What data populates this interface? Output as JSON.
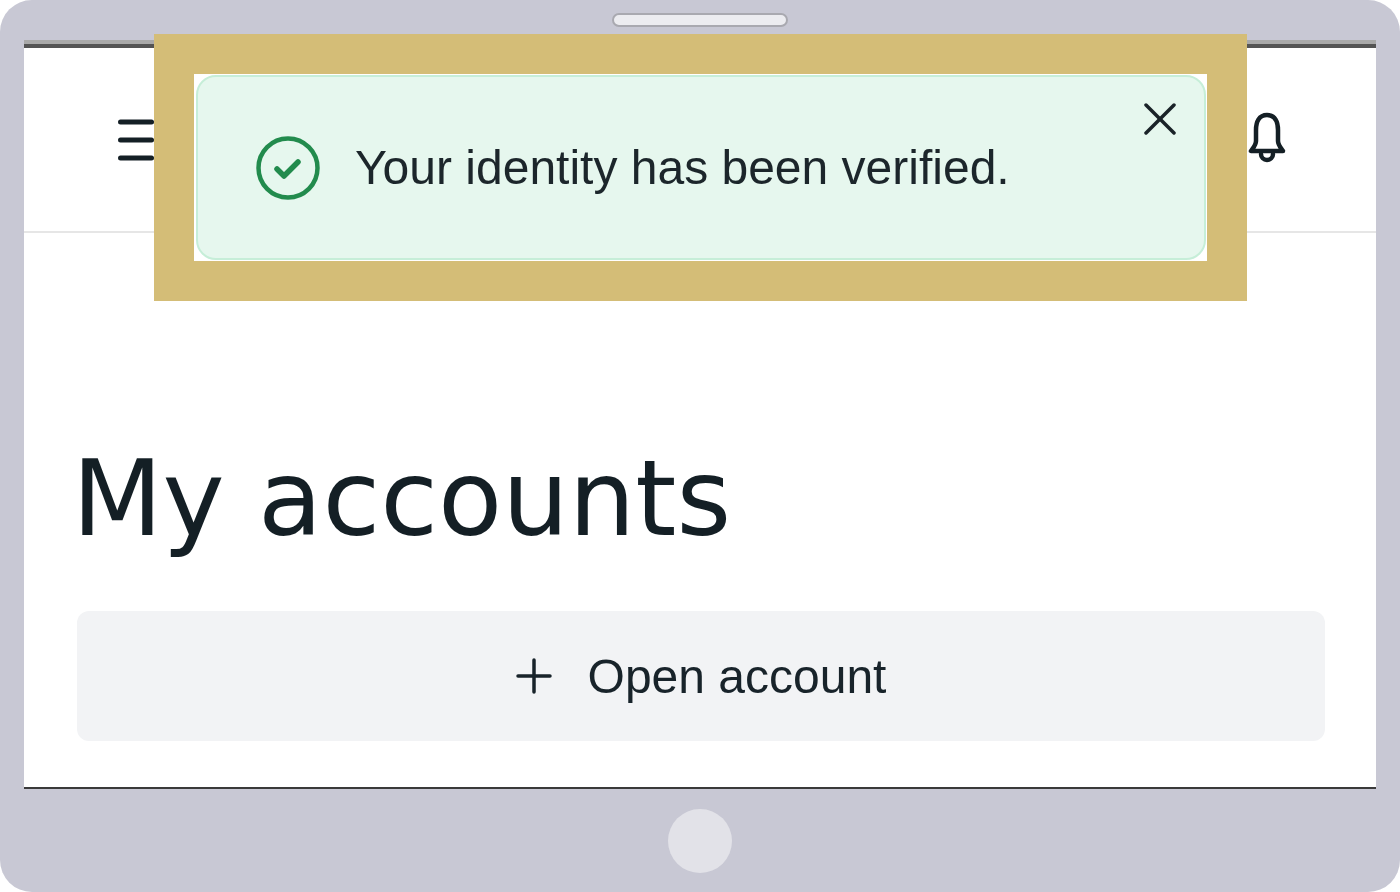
{
  "toast": {
    "message": "Your identity has been verified."
  },
  "main": {
    "title": "My accounts",
    "open_account_button": {
      "label": "Open account"
    }
  }
}
